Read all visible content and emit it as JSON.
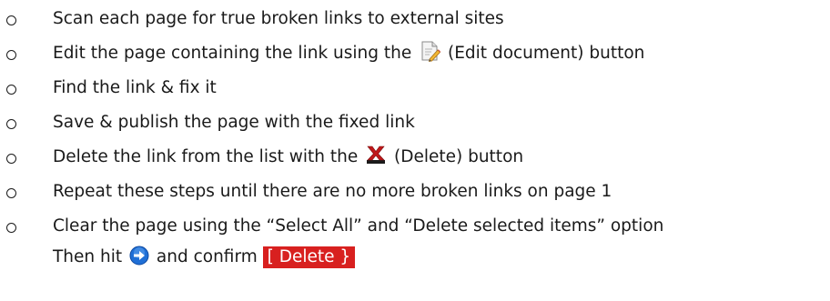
{
  "steps": [
    {
      "text": "Scan each page for true broken links to external sites"
    },
    {
      "before": "Edit the page containing the link using the ",
      "icon": "edit-document-icon",
      "after": " (Edit document) button"
    },
    {
      "text": "Find the link & fix it"
    },
    {
      "text": "Save & publish the page with the fixed link"
    },
    {
      "before": "Delete the link from the list with the ",
      "icon": "delete-icon",
      "after": " (Delete) button"
    },
    {
      "text": "Repeat these steps until there are no more broken links on page 1"
    },
    {
      "line1": "Clear the page using the “Select All” and “Delete selected items” option",
      "line2_before": "Then hit ",
      "line2_icon": "go-arrow-icon",
      "line2_middle": " and confirm ",
      "line2_button": "[ Delete }"
    }
  ],
  "colors": {
    "text": "#1a1a1a",
    "delete_button_bg": "#d8201f",
    "delete_button_text": "#ffffff",
    "go_arrow": "#1f6fd6",
    "delete_icon": "#c0181a"
  }
}
